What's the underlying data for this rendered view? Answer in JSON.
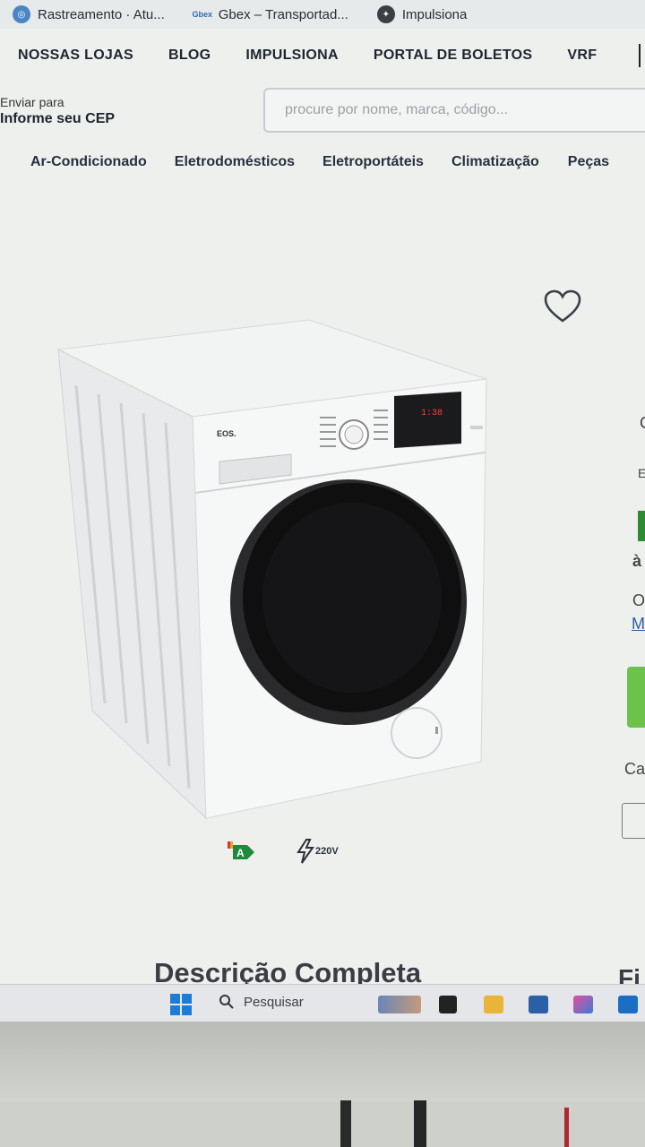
{
  "bookmarks": [
    {
      "label": "Rastreamento · Atu...",
      "icon": "tracking-icon"
    },
    {
      "label": "Gbex – Transportad...",
      "icon": "gbex-icon"
    },
    {
      "label": "Impulsiona",
      "icon": "impulsiona-icon"
    }
  ],
  "topnav": [
    "NOSSAS LOJAS",
    "BLOG",
    "IMPULSIONA",
    "PORTAL DE BOLETOS",
    "VRF"
  ],
  "cep": {
    "label": "Enviar para",
    "value": "Informe seu CEP"
  },
  "search": {
    "placeholder": "procure por nome, marca, código..."
  },
  "categories": [
    "Ar-Condicionado",
    "Eletrodomésticos",
    "Eletroportáteis",
    "Climatização",
    "Peças"
  ],
  "product": {
    "brand": "EOS.",
    "display": "1:38",
    "voltage": "220V",
    "energy_class": "A"
  },
  "section": {
    "title": "Descrição Completa",
    "right_title": "Fi"
  },
  "right_panel": {
    "c1": "C",
    "c2": "E",
    "c3": "à",
    "c4": "O",
    "c5": "M",
    "c6": "Ca"
  },
  "taskbar": {
    "search_label": "Pesquisar"
  }
}
